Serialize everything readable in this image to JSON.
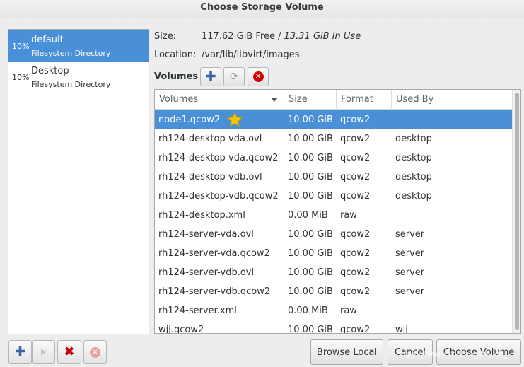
{
  "window": {
    "title": "Choose Storage Volume"
  },
  "pools": [
    {
      "percent": "10%",
      "name": "default",
      "type": "Filesystem Directory",
      "selected": true
    },
    {
      "percent": "10%",
      "name": "Desktop",
      "type": "Filesystem Directory",
      "selected": false
    }
  ],
  "info": {
    "size_label": "Size:",
    "size_free": "117.62 GiB Free /",
    "size_in_use": "13.31 GiB In Use",
    "location_label": "Location:",
    "location_value": "/var/lib/libvirt/images"
  },
  "volumes_toolbar": {
    "label": "Volumes",
    "add_icon": "plus-icon",
    "refresh_icon": "refresh-icon",
    "delete_icon": "stop-icon"
  },
  "table": {
    "columns": [
      "Volumes",
      "Size",
      "Format",
      "Used By"
    ],
    "rows": [
      {
        "name": "node1.qcow2",
        "size": "10.00 GiB",
        "format": "qcow2",
        "used_by": "",
        "selected": true,
        "star": true
      },
      {
        "name": "rh124-desktop-vda.ovl",
        "size": "10.00 GiB",
        "format": "qcow2",
        "used_by": "desktop"
      },
      {
        "name": "rh124-desktop-vda.qcow2",
        "size": "10.00 GiB",
        "format": "qcow2",
        "used_by": "desktop"
      },
      {
        "name": "rh124-desktop-vdb.ovl",
        "size": "10.00 GiB",
        "format": "qcow2",
        "used_by": "desktop"
      },
      {
        "name": "rh124-desktop-vdb.qcow2",
        "size": "10.00 GiB",
        "format": "qcow2",
        "used_by": "desktop"
      },
      {
        "name": "rh124-desktop.xml",
        "size": "0.00 MiB",
        "format": "raw",
        "used_by": ""
      },
      {
        "name": "rh124-server-vda.ovl",
        "size": "10.00 GiB",
        "format": "qcow2",
        "used_by": "server"
      },
      {
        "name": "rh124-server-vda.qcow2",
        "size": "10.00 GiB",
        "format": "qcow2",
        "used_by": "server"
      },
      {
        "name": "rh124-server-vdb.ovl",
        "size": "10.00 GiB",
        "format": "qcow2",
        "used_by": "server"
      },
      {
        "name": "rh124-server-vdb.qcow2",
        "size": "10.00 GiB",
        "format": "qcow2",
        "used_by": "server"
      },
      {
        "name": "rh124-server.xml",
        "size": "0.00 MiB",
        "format": "raw",
        "used_by": ""
      },
      {
        "name": "wjj.qcow2",
        "size": "10.00 GiB",
        "format": "qcow2",
        "used_by": "wjj"
      }
    ]
  },
  "pool_toolbar": {
    "add_icon": "plus-icon",
    "start_icon": "play-icon",
    "delete_icon": "x-icon",
    "stop_icon": "stop-icon"
  },
  "buttons": {
    "browse_local": "Browse Local",
    "cancel": "Cancel",
    "choose_volume": "Choose Volume"
  },
  "watermark": "https://blog.csdn.net/weixin_..."
}
